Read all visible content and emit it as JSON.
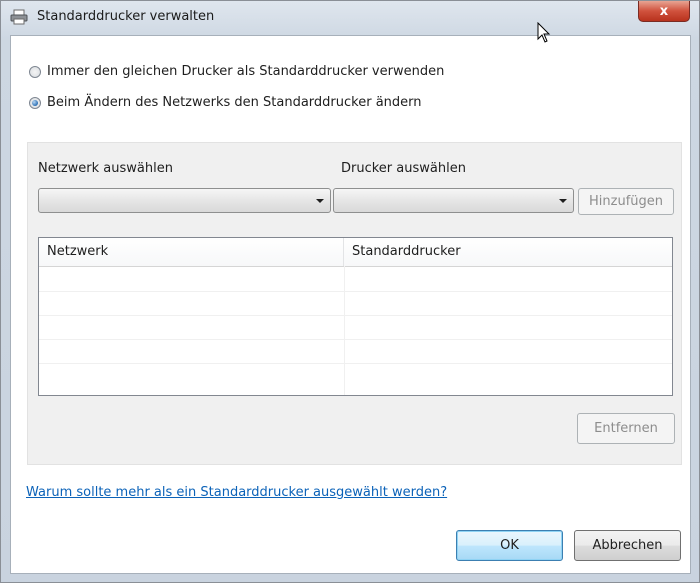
{
  "window": {
    "title": "Standarddrucker verwalten",
    "title_icon": "printer-icon",
    "close_glyph": "x"
  },
  "options": {
    "same_printer_label": "Immer den gleichen Drucker als Standarddrucker verwenden",
    "change_with_network_label": "Beim Ändern des Netzwerks den Standarddrucker ändern",
    "selected": "change_with_network"
  },
  "selection": {
    "network_label": "Netzwerk auswählen",
    "network_value": "",
    "printer_label": "Drucker auswählen",
    "printer_value": "",
    "add_button": "Hinzufügen"
  },
  "table": {
    "columns": [
      "Netzwerk",
      "Standarddrucker"
    ],
    "rows": []
  },
  "remove_button": "Entfernen",
  "help_link": "Warum sollte mehr als ein Standarddrucker ausgewählt werden?",
  "footer": {
    "ok": "OK",
    "cancel": "Abbrechen"
  },
  "colors": {
    "link": "#0b62b8",
    "close_button": "#c8422c",
    "default_button_border": "#3c7fb1"
  }
}
